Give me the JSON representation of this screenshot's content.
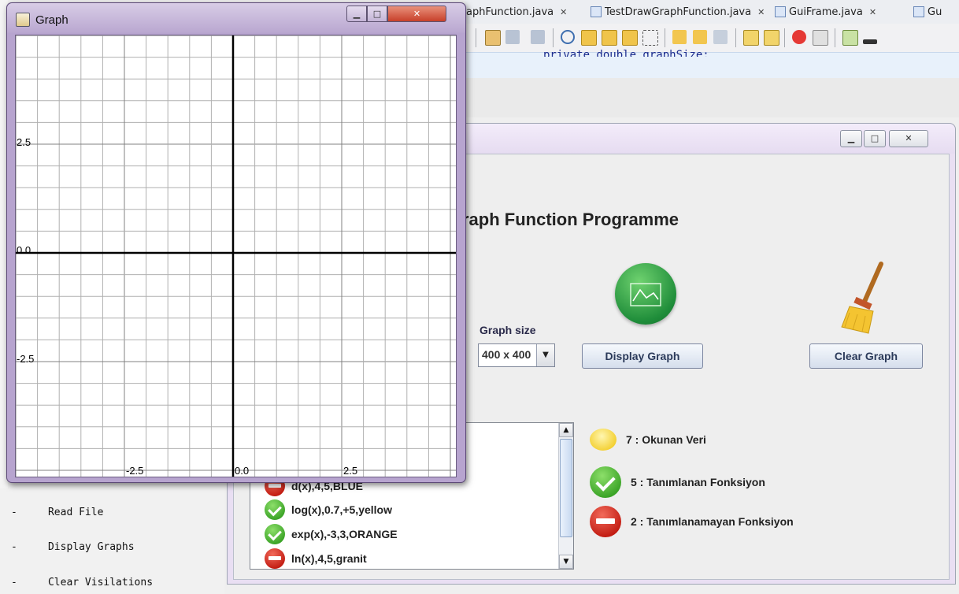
{
  "ide": {
    "tabs": [
      {
        "label": "aphFunction.java"
      },
      {
        "label": "TestDrawGraphFunction.java"
      },
      {
        "label": "GuiFrame.java"
      },
      {
        "label": "Gu"
      }
    ],
    "tab_close": "✕",
    "code_fragment": "private double graphSize;",
    "outline_items": [
      "Read File",
      "Display Graphs",
      "Clear Visilations"
    ],
    "bullet": "-"
  },
  "main_window": {
    "title_heading": "raph Function Programme",
    "graph_size_label": "Graph size",
    "graph_size_value": "400 x 400",
    "display_button": "Display Graph",
    "clear_button": "Clear Graph",
    "list_items": [
      {
        "text": "d(x),4,5,BLUE",
        "status": "error"
      },
      {
        "text": "log(x),0.7,+5,yellow",
        "status": "ok"
      },
      {
        "text": "exp(x),-3,3,ORANGE",
        "status": "ok"
      },
      {
        "text": "ln(x),4,5,granit",
        "status": "error"
      }
    ],
    "stats": [
      {
        "text": "7 : Okunan Veri",
        "icon": "speech-bubble-icon"
      },
      {
        "text": "5 : Tanımlanan Fonksiyon",
        "icon": "checkmark-icon"
      },
      {
        "text": "2 : Tanımlanamayan Fonksiyon",
        "icon": "no-entry-icon"
      }
    ]
  },
  "graph_window": {
    "title": "Graph",
    "labels": {
      "y_pos": "2.5",
      "y_zero": "0.0",
      "y_neg": "-2.5",
      "x_neg": "-2.5",
      "x_zero": "0.0",
      "x_pos": "2.5"
    },
    "colors": {
      "grid": "#b0b0b0",
      "axis": "#000000",
      "major": "#808080"
    }
  }
}
